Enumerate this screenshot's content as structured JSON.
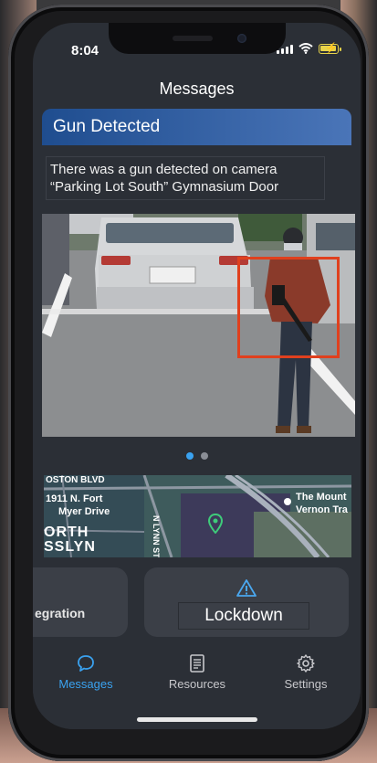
{
  "status_bar": {
    "time": "8:04",
    "battery_color": "#e8d44a"
  },
  "header": {
    "title": "Messages"
  },
  "alert": {
    "title": "Gun Detected",
    "description_line_1": "There was a gun detected on camera",
    "description_line_2": "“Parking Lot South” Gymnasium Door",
    "header_gradient": [
      "#1f4d8f",
      "#4a75b8"
    ],
    "detection_box_color": "#e0401e"
  },
  "carousel": {
    "page_count": 2,
    "active_index": 0,
    "active_color": "#3aa2f0"
  },
  "map": {
    "labels": {
      "street_1": "OSTON BLVD",
      "address_1": "1911 N. Fort",
      "address_2": "Myer Drive",
      "area_1": "ORTH",
      "area_2": "SSLYN",
      "street_2": "N LYNN ST",
      "poi_1": "The Mount",
      "poi_2": "Vernon Tra"
    }
  },
  "actions": {
    "left_button_label": "egration",
    "lockdown_label": "Lockdown"
  },
  "tab_bar": {
    "active_color": "#3aa2f0",
    "tabs": [
      {
        "label": "Messages",
        "icon": "chat-bubble-icon"
      },
      {
        "label": "Resources",
        "icon": "document-icon"
      },
      {
        "label": "Settings",
        "icon": "gear-icon"
      }
    ]
  }
}
